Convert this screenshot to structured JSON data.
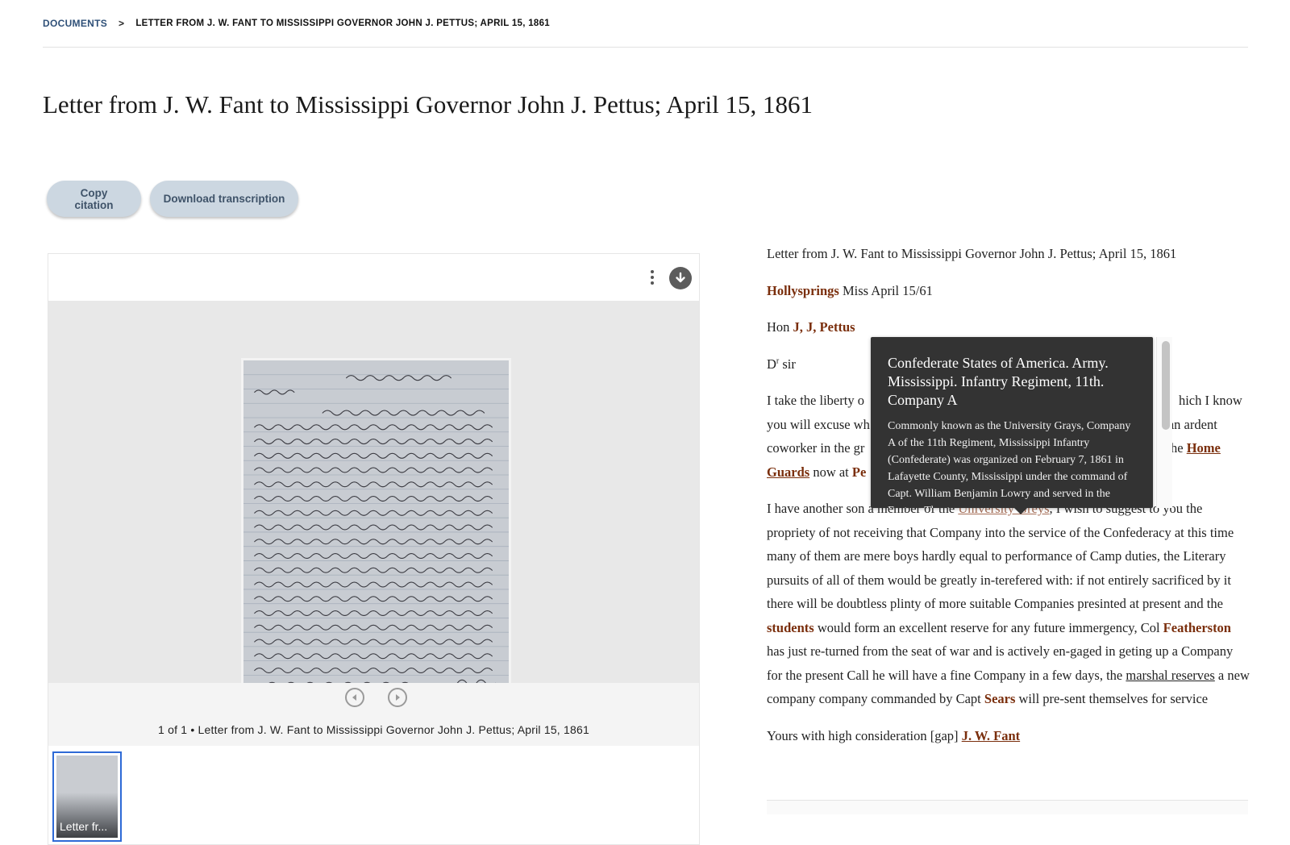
{
  "breadcrumb": {
    "root": "DOCUMENTS",
    "separator": ">",
    "current": "LETTER FROM J. W. FANT TO MISSISSIPPI GOVERNOR JOHN J. PETTUS; APRIL 15, 1861"
  },
  "page_title": "Letter from J. W. Fant to Mississippi Governor John J. Pettus; April 15, 1861",
  "actions": {
    "copy_citation": "Copy citation",
    "download_transcription": "Download transcription"
  },
  "viewer": {
    "menu_icon": "kebab-vertical-icon",
    "download_icon": "download-circle-icon",
    "prev_icon": "chevron-left-circle-icon",
    "next_icon": "chevron-right-circle-icon",
    "caption": "1 of 1 • Letter from J. W. Fant to Mississippi Governor John J. Pettus; April 15, 1861",
    "thumbnail_label": "Letter fr..."
  },
  "transcript": {
    "heading": "Letter from J. W. Fant to Mississippi Governor John J. Pettus; April 15, 1861",
    "p1": {
      "place": "Hollysprings",
      "rest": " Miss April 15/61"
    },
    "p2": {
      "prefix": "Hon ",
      "name": "J, J, Pettus"
    },
    "p3": {
      "d": "D",
      "sup": "r",
      "rest": " sir"
    },
    "p4": {
      "line1_start": "I take the liberty o",
      "line1_end": "hich I know",
      "line2_start": "you will excuse wh",
      "line2_end": "an ardent",
      "line3_start": "coworker in the gr",
      "line3_end": "the ",
      "home": "Home",
      "guards": "Guards",
      "now_at": " now at ",
      "pen": "Pe"
    },
    "p5": {
      "t1": "I have another son a member of the ",
      "greys": "University Greys",
      "t2": ", I wish to suggest to you the propriety of not receiving that Company into the service of the Confederacy at this time many of them are mere boys hardly equal to performance of Camp duties, the Literary pursuits of all of them would be greatly in-terefered with: if not entirely sacrificed by it there will be doubtless plinty of more suitable Companies presinted at present and the ",
      "students": "students",
      "t3": " would form an excellent reserve for any future immergency, Col ",
      "featherston": "Featherston",
      "t4": " has just re-turned from the seat of war and is actively en-gaged in geting up a Company for the present Call he will have a fine Company in a few days, the ",
      "marshal": "marshal reserves",
      "t5": " a new company company commanded by Capt ",
      "sears": "Sears",
      "t6": " will pre-sent themselves for service"
    },
    "p6": {
      "text": "Yours with high consideration [gap] ",
      "signer": "J. W. Fant"
    }
  },
  "tooltip": {
    "title": "Confederate States of America. Army. Mississippi. Infantry Regiment, 11th. Company A",
    "body": "Commonly known as the University Grays, Company A of the 11th Regiment, Mississippi Infantry (Confederate) was organized on February 7, 1861 in Lafayette County, Mississippi under the command of Capt. William Benjamin Lowry and served in the Eastern Theater"
  },
  "colors": {
    "accent_link": "#7a2e0c",
    "button_bg": "#ccd7e1",
    "tooltip_bg": "#333333",
    "thumbnail_border": "#2e6ad6"
  }
}
